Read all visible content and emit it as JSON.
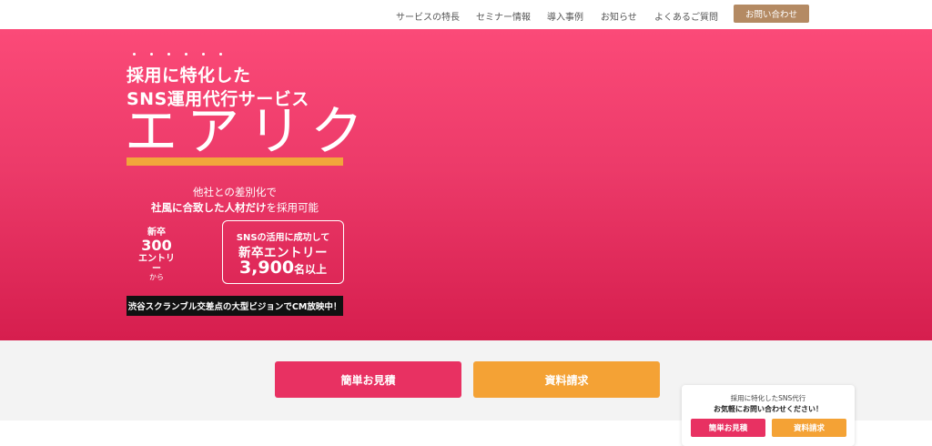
{
  "header": {
    "nav": [
      {
        "label": "サービスの特長"
      },
      {
        "label": "セミナー情報"
      },
      {
        "label": "導入事例"
      },
      {
        "label": "お知らせ"
      },
      {
        "label": "よくあるご質問"
      }
    ],
    "contact_label": "お問い合わせ"
  },
  "hero": {
    "headline_1": "採用に特化した",
    "headline_2": "SNS運用代行サービス",
    "brand": "エアリク",
    "tagline_1": "他社との差別化で",
    "tagline_2_bold": "社風に合致した人材だけ",
    "tagline_2_rest": "を採用可能",
    "stat_left": {
      "line1": "新卒",
      "line2": "300",
      "line3": "エントリー",
      "line4": "から"
    },
    "stat_box": {
      "line1": "SNSの活用に成功して",
      "line2": "新卒エントリー",
      "number": "3,900",
      "suffix": "名以上"
    },
    "cm_notice": "渋谷スクランブル交差点の大型ビジョンでCM放映中！"
  },
  "cta": {
    "estimate_label": "簡単お見積",
    "docs_label": "資料請求"
  },
  "floating": {
    "line1": "採用に特化したSNS代行",
    "line2": "お気軽にお問い合わせください！",
    "estimate_label": "簡単お見積",
    "docs_label": "資料請求"
  },
  "colors": {
    "brand_pink": "#e83162",
    "accent_orange": "#f4a235",
    "contact_brown": "#b48a63"
  }
}
